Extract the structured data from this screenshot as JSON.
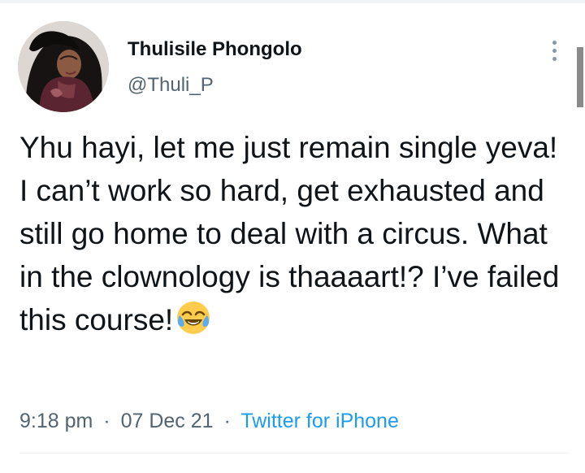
{
  "tweet": {
    "author": {
      "display_name": "Thulisile Phongolo",
      "handle": "@Thuli_P",
      "avatar_icon": "profile-photo"
    },
    "text": "Yhu hayi, let me just remain single yeva! I can’t work so hard, get exhausted and still go home to deal with a circus. What in the clownology is thaaaart!? I’ve failed this course!",
    "emoji_icon": "face-with-tears-of-joy-emoji",
    "time": "9:18 pm",
    "date": "07 Dec 21",
    "separator": "·",
    "source": "Twitter for iPhone"
  },
  "colors": {
    "text": "#0f1419",
    "muted": "#536471",
    "link": "#1d9bf0",
    "divider": "#eff3f4"
  },
  "icons": {
    "more": "more-vertical-icon"
  }
}
